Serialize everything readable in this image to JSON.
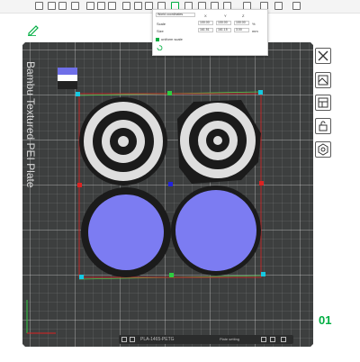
{
  "toolbar": {
    "icons": [
      "add-icon",
      "grid-icon",
      "layout-icon",
      "split-icon",
      "file-icon",
      "copy-icon",
      "object-icon",
      "flag-icon",
      "lock-icon",
      "move-icon",
      "rotate-icon",
      "scale-icon",
      "cut-icon",
      "measure-icon",
      "support-icon",
      "seam-icon",
      "text-icon",
      "fit-icon",
      "assembly-icon"
    ]
  },
  "edit_icon": "pencil-icon",
  "scale_panel": {
    "coordinate_system": "World coordinates",
    "axes": [
      "X",
      "Y",
      "Z"
    ],
    "scale_label": "Scale",
    "scale_values": [
      "100.00",
      "100.00",
      "100.00"
    ],
    "scale_unit": "%",
    "size_label": "Size",
    "size_values": [
      "161.51",
      "161.15",
      "3.00"
    ],
    "size_unit": "mm",
    "uniform_scale_label": "uniform scale"
  },
  "plate": {
    "name": "Bambu Textured PEI Plate",
    "number": "01",
    "bottom_bar_text": "PLA-1465-PETG",
    "bottom_bar_right_label": "Plate setting"
  },
  "filament_colors": [
    "#6f6fe8",
    "#ffffff",
    "#222222"
  ],
  "model_colors": {
    "ring_dark": "#1b1b1b",
    "ring_light": "#dedede",
    "disc": "#7c7cf2",
    "selection_box": "#dd2222",
    "handle": "#16c8e0",
    "hull": "#4fc24f"
  },
  "right_panel": [
    "close-icon",
    "arrange-icon",
    "layout-icon",
    "lock-icon",
    "settings-icon"
  ]
}
